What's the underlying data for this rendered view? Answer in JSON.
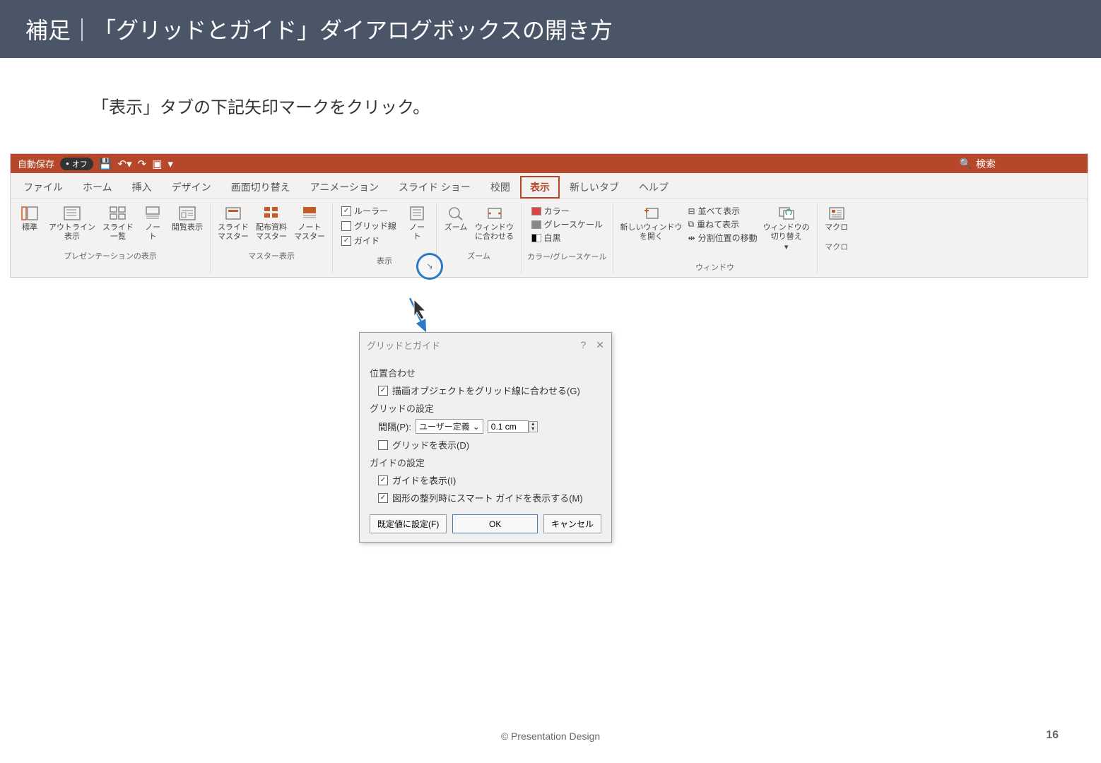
{
  "slide": {
    "title": "補足｜「グリッドとガイド」ダイアログボックスの開き方",
    "instruction": "「表示」タブの下記矢印マークをクリック。",
    "footer": "© Presentation Design",
    "page_number": "16"
  },
  "qat": {
    "autosave_label": "自動保存",
    "autosave_state": "オフ",
    "search_label": "検索"
  },
  "tabs": [
    "ファイル",
    "ホーム",
    "挿入",
    "デザイン",
    "画面切り替え",
    "アニメーション",
    "スライド ショー",
    "校閲",
    "表示",
    "新しいタブ",
    "ヘルプ"
  ],
  "active_tab_index": 8,
  "ribbon": {
    "groups": {
      "presentation_views": {
        "label": "プレゼンテーションの表示",
        "buttons": [
          "標準",
          "アウトライン\n表示",
          "スライド\n一覧",
          "ノー\nト",
          "閲覧表示"
        ]
      },
      "master_views": {
        "label": "マスター表示",
        "buttons": [
          "スライド\nマスター",
          "配布資料\nマスター",
          "ノート\nマスター"
        ]
      },
      "show": {
        "label": "表示",
        "ruler": "ルーラー",
        "gridlines": "グリッド線",
        "guides": "ガイド",
        "notes": "ノー\nト"
      },
      "zoom": {
        "label": "ズーム",
        "zoom_btn": "ズーム",
        "fit_btn": "ウィンドウ\nに合わせる"
      },
      "color": {
        "label": "カラー/グレースケール",
        "color": "カラー",
        "grayscale": "グレースケール",
        "bw": "白黒"
      },
      "window": {
        "label": "ウィンドウ",
        "new_window": "新しいウィンドウ\nを開く",
        "arrange": "並べて表示",
        "cascade": "重ねて表示",
        "move_split": "分割位置の移動",
        "switch": "ウィンドウの\n切り替え"
      },
      "macros": {
        "label": "マクロ",
        "btn": "マクロ"
      }
    }
  },
  "dialog": {
    "title": "グリッドとガイド",
    "section_snap": "位置合わせ",
    "snap_to_grid": "描画オブジェクトをグリッド線に合わせる(G)",
    "section_grid": "グリッドの設定",
    "spacing_label": "間隔(P):",
    "spacing_select": "ユーザー定義",
    "spacing_value": "0.1 cm",
    "display_grid": "グリッドを表示(D)",
    "section_guide": "ガイドの設定",
    "display_guides": "ガイドを表示(I)",
    "smart_guides": "図形の整列時にスマート ガイドを表示する(M)",
    "buttons": {
      "default": "既定値に設定(F)",
      "ok": "OK",
      "cancel": "キャンセル"
    }
  }
}
